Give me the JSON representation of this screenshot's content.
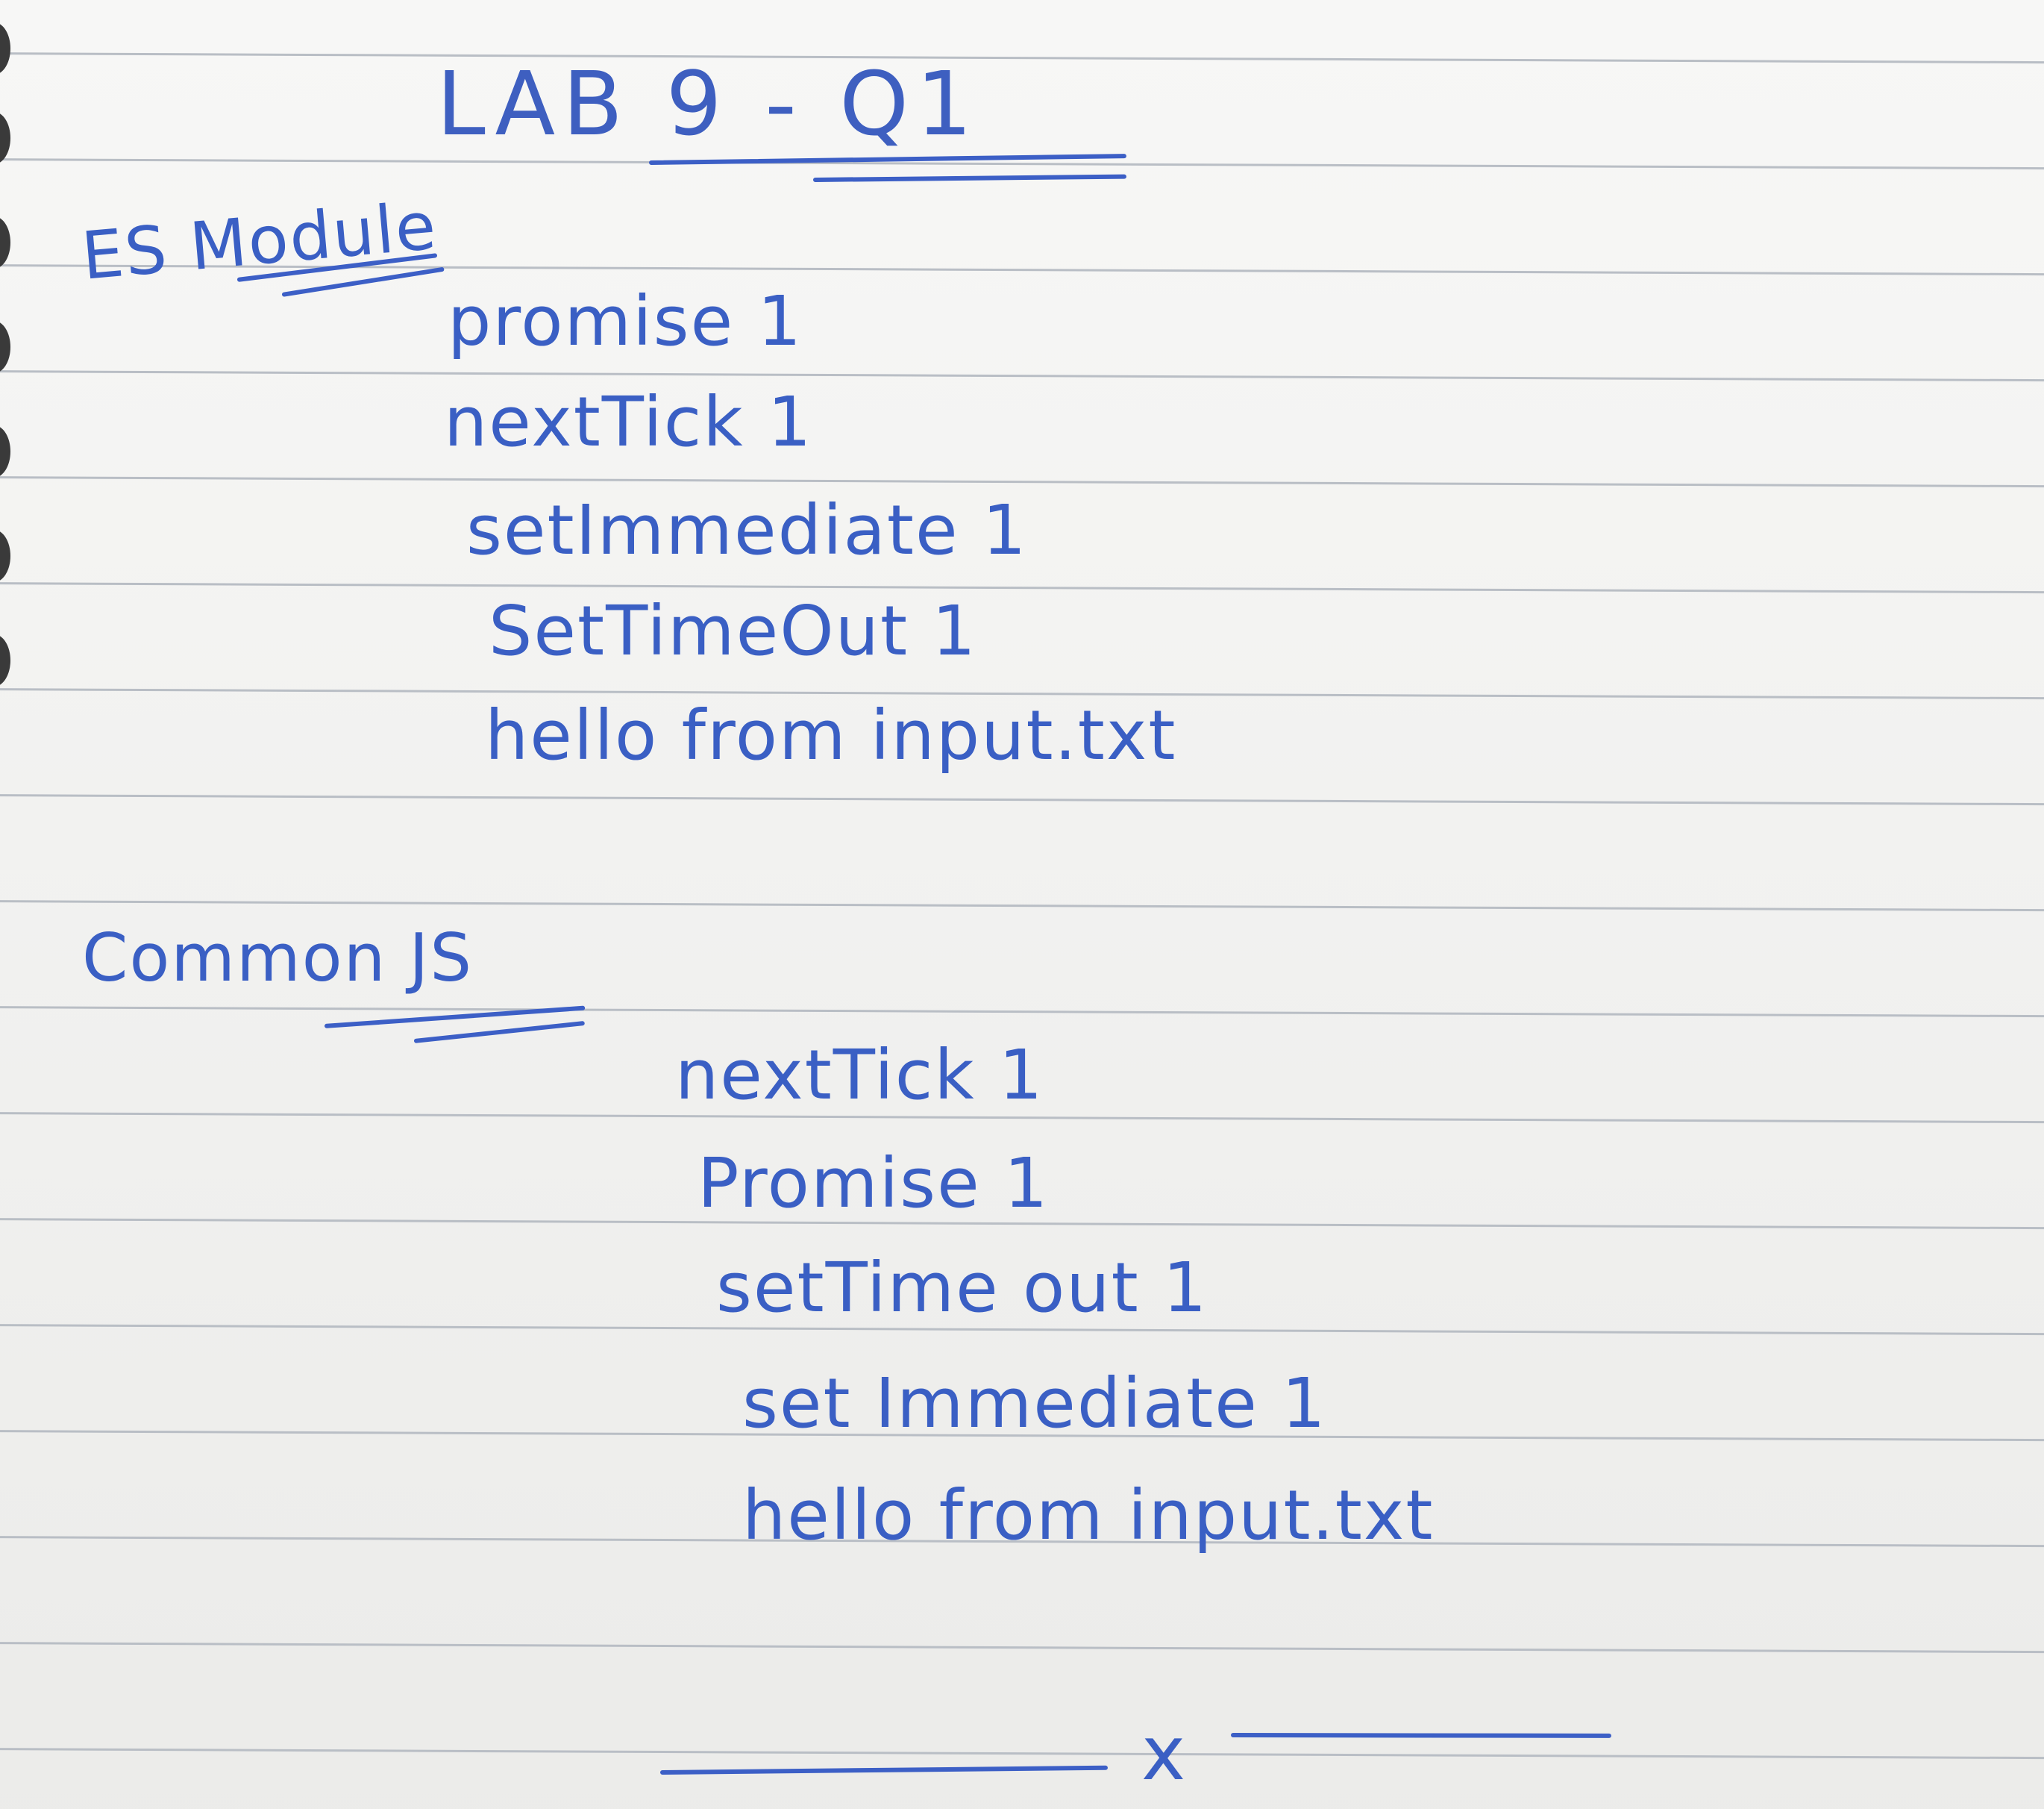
{
  "note": {
    "title": "LAB 9 - Q1",
    "sections": [
      {
        "heading": "ES Module",
        "lines": [
          "promise 1",
          "nextTick 1",
          "setImmediate 1",
          "SetTimeOut 1",
          "hello from input.txt"
        ]
      },
      {
        "heading": "Common JS",
        "lines": [
          "nextTick 1",
          "Promise 1",
          "setTime out 1",
          "set Immediate 1",
          "hello from input.txt"
        ]
      }
    ],
    "end_mark": "x"
  },
  "colors": {
    "ink": "#3a5fc4",
    "paper": "#f3f3f1",
    "rule": "#b9bec5"
  }
}
